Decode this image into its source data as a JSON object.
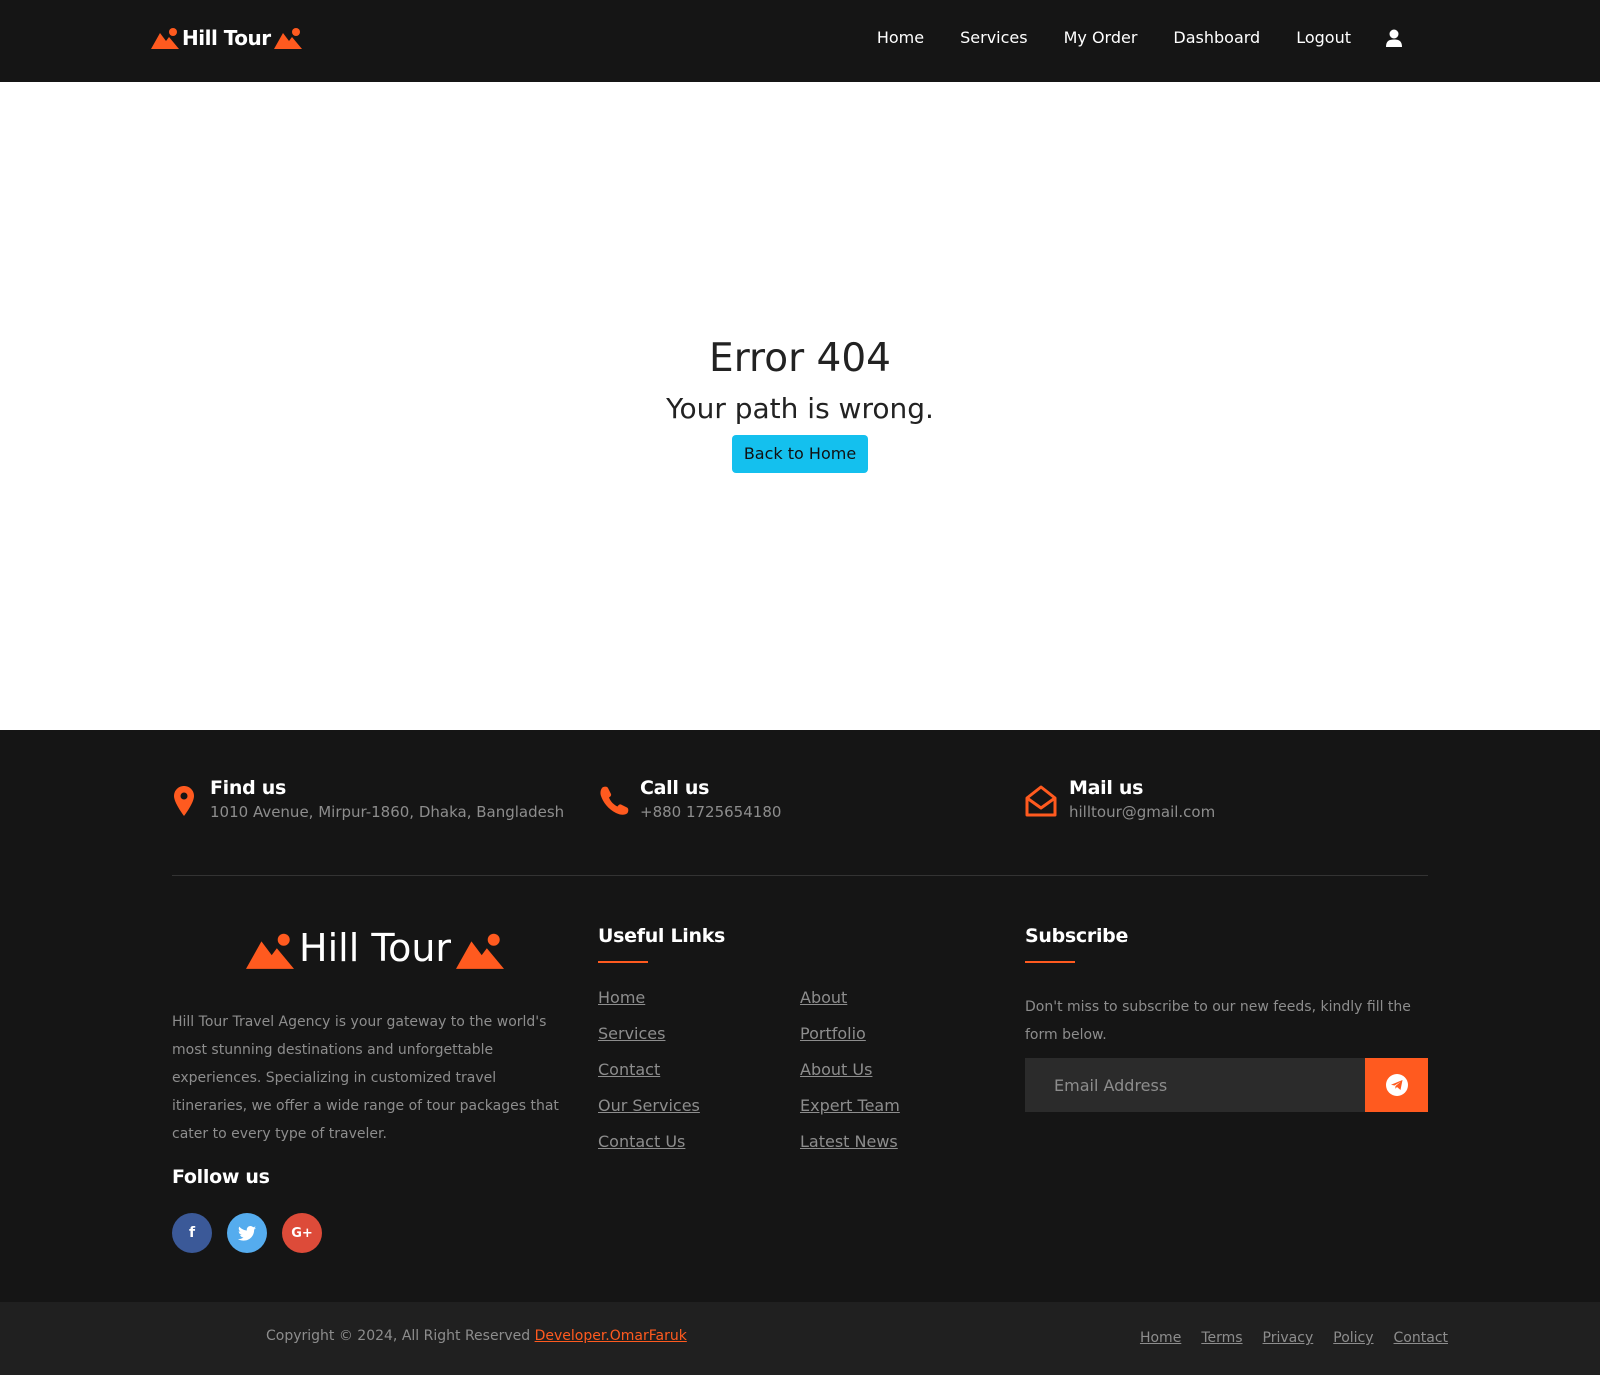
{
  "brand": {
    "name": "Hill Tour"
  },
  "nav": {
    "items": [
      "Home",
      "Services",
      "My Order",
      "Dashboard",
      "Logout"
    ],
    "user_icon": "user-icon"
  },
  "error": {
    "title": "Error 404",
    "subtitle": "Your path is wrong.",
    "button": "Back to Home"
  },
  "footer": {
    "contacts": [
      {
        "title": "Find us",
        "value": "1010 Avenue, Mirpur-1860, Dhaka, Bangladesh",
        "icon": "map-pin-icon"
      },
      {
        "title": "Call us",
        "value": "+880 1725654180",
        "icon": "phone-icon"
      },
      {
        "title": "Mail us",
        "value": "hilltour@gmail.com",
        "icon": "envelope-open-icon"
      }
    ],
    "logo_text": "Hill Tour",
    "about": "Hill Tour Travel Agency is your gateway to the world's most stunning destinations and unforgettable experiences. Specializing in customized travel itineraries, we offer a wide range of tour packages that cater to every type of traveler.",
    "follow_title": "Follow us",
    "social": [
      {
        "icon": "facebook-icon",
        "glyph": "f",
        "color": "#3b5998"
      },
      {
        "icon": "twitter-icon",
        "glyph": "",
        "color": "#55acee"
      },
      {
        "icon": "google-plus-icon",
        "glyph": "G+",
        "color": "#dd4b39"
      }
    ],
    "useful_links_title": "Useful Links",
    "links_left": [
      "Home",
      "Services",
      "Contact",
      "Our Services",
      "Contact Us"
    ],
    "links_right": [
      "About",
      "Portfolio",
      "About Us",
      "Expert Team",
      "Latest News"
    ],
    "subscribe_title": "Subscribe",
    "subscribe_text": "Don't miss to subscribe to our new feeds, kindly fill the form below.",
    "email_placeholder": "Email Address",
    "send_icon": "telegram-send-icon"
  },
  "bottom": {
    "copyright": "Copyright © 2024, All Right Reserved ",
    "developer": "Developer.OmarFaruk",
    "links": [
      "Home",
      "Terms",
      "Privacy",
      "Policy",
      "Contact"
    ]
  },
  "colors": {
    "accent": "#ff5a1f",
    "button": "#14c0ee",
    "dark": "#151515"
  }
}
